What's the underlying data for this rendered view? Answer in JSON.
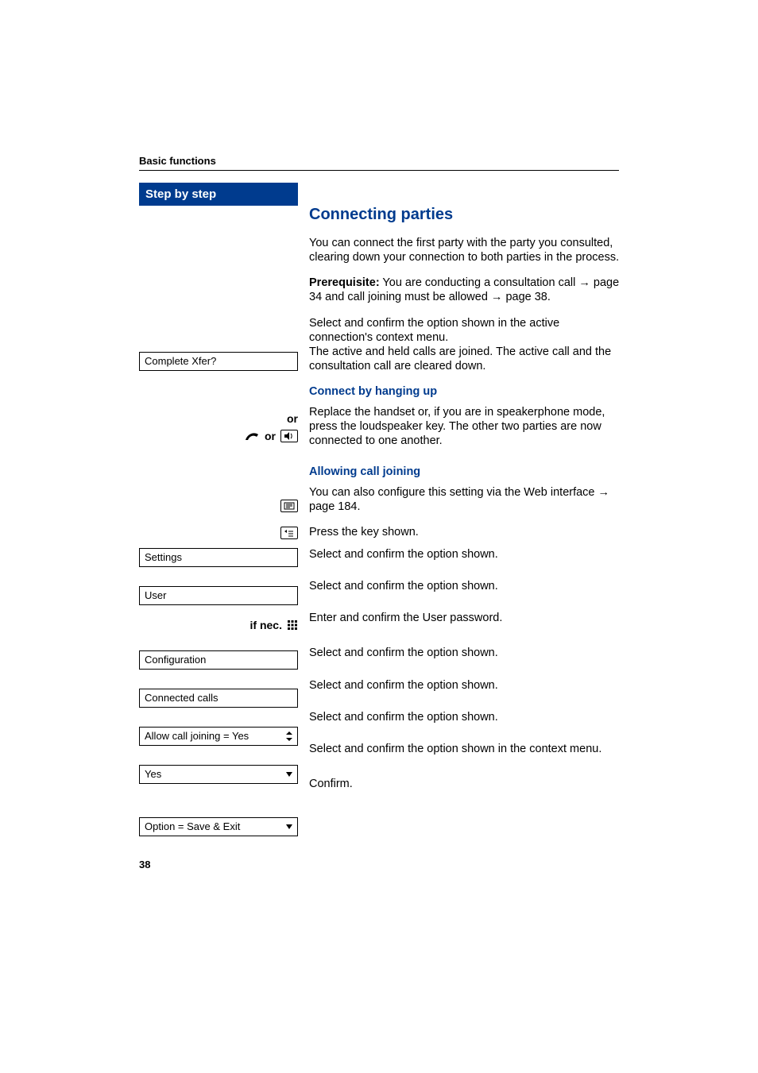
{
  "header": "Basic functions",
  "sidebar_title": "Step by step",
  "h2": "Connecting parties",
  "intro": "You can connect the first party with the party you consulted, clearing down your connection to both parties in the process.",
  "prereq_bold": "Prerequisite:",
  "prereq_text_a": " You are conducting a consultation call ",
  "prereq_arrow1": "→",
  "prereq_text_b": " page 34 and call joining must be allowed ",
  "prereq_arrow2": "→",
  "prereq_text_c": " page 38.",
  "box_complete": "Complete Xfer?",
  "complete_text_a": "Select and confirm the option shown in the active connection's context menu.",
  "complete_text_b": "The active and held calls are joined. The active call and the consultation call are cleared down.",
  "or_label": "or",
  "h3_connect": "Connect by hanging up",
  "or_icons_label": "or",
  "hangup_text": "Replace the handset or, if you are in speakerphone mode, press the loudspeaker key. The other two parties are now connected to one another.",
  "h3_allow": "Allowing call joining",
  "web_text_a": "You can also configure this setting via the Web interface ",
  "web_arrow": "→",
  "web_text_b": " page 184.",
  "press_key": "Press the key shown.",
  "box_settings": "Settings",
  "settings_text": "Select and confirm the option shown.",
  "box_user": "User",
  "user_text": "Select and confirm the option shown.",
  "ifnec_label": "if nec.",
  "ifnec_text": "Enter and confirm the User password.",
  "box_config": "Configuration",
  "config_text": "Select and confirm the option shown.",
  "box_connected": "Connected calls",
  "connected_text": "Select and confirm the option shown.",
  "box_allow": "Allow call joining = Yes",
  "allow_text": "Select and confirm the option shown.",
  "box_yes": "Yes",
  "yes_text": "Select and confirm the option shown in the context menu.",
  "box_option": "Option = Save & Exit",
  "option_text": "Confirm.",
  "page_number": "38"
}
